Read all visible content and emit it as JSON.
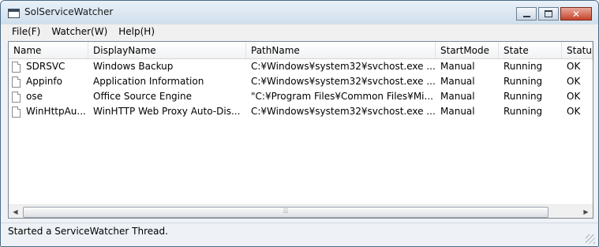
{
  "window": {
    "title": "SolServiceWatcher",
    "icon": "app-window-icon"
  },
  "menu": [
    {
      "label": "File(F)"
    },
    {
      "label": "Watcher(W)"
    },
    {
      "label": "Help(H)"
    }
  ],
  "list": {
    "columns": [
      "Name",
      "DisplayName",
      "PathName",
      "StartMode",
      "State",
      "Status"
    ],
    "rows": [
      [
        "SDRSVC",
        "Windows Backup",
        "C:¥Windows¥system32¥svchost.exe ...",
        "Manual",
        "Running",
        "OK"
      ],
      [
        "Appinfo",
        "Application Information",
        "C:¥Windows¥system32¥svchost.exe ...",
        "Manual",
        "Running",
        "OK"
      ],
      [
        "ose",
        "Office Source Engine",
        "\"C:¥Program Files¥Common Files¥Mi...",
        "Manual",
        "Running",
        "OK"
      ],
      [
        "WinHttpAu...",
        "WinHTTP Web Proxy Auto-Dis...",
        "C:¥Windows¥system32¥svchost.exe ...",
        "Manual",
        "Running",
        "OK"
      ]
    ]
  },
  "scrollbar": {
    "grip": "⦙⦙⦙"
  },
  "status": {
    "text": "Started a ServiceWatcher Thread."
  }
}
